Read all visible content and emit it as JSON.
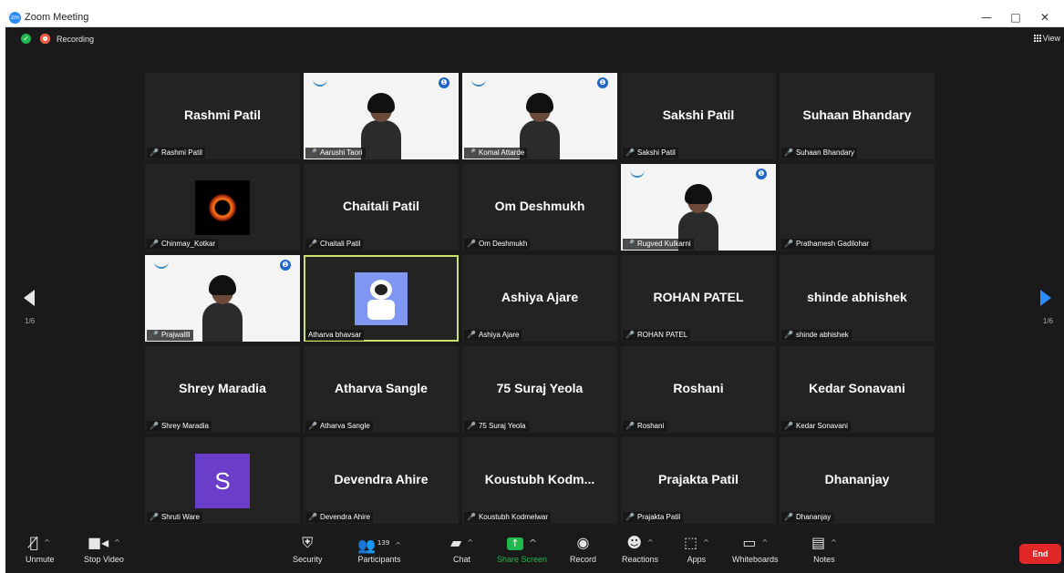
{
  "window": {
    "title": "Zoom Meeting",
    "minimize": "—",
    "restore": "□",
    "close": "✕"
  },
  "topbar": {
    "recording": "Recording",
    "view": "View"
  },
  "pages": {
    "left": "1/6",
    "right": "1/6"
  },
  "tiles": [
    {
      "name": "Rashmi Patil",
      "label": "Rashmi Patil",
      "type": "name"
    },
    {
      "name": "Aarushi Taori",
      "label": "Aarushi Taori",
      "type": "video"
    },
    {
      "name": "Komal Attarde",
      "label": "Komal Attarde",
      "type": "video"
    },
    {
      "name": "Sakshi Patil",
      "label": "Sakshi Patil",
      "type": "name"
    },
    {
      "name": "Suhaan Bhandary",
      "label": "Suhaan Bhandary",
      "type": "name"
    },
    {
      "name": "Chinmay_Kotkar",
      "label": "Chinmay_Kotkar",
      "type": "image-blackhole"
    },
    {
      "name": "Chaitali Patil",
      "label": "Chaitali Patil",
      "type": "name"
    },
    {
      "name": "Om Deshmukh",
      "label": "Om Deshmukh",
      "type": "name"
    },
    {
      "name": "Rugved Kulkarni",
      "label": "Rugved Kulkarni",
      "type": "video"
    },
    {
      "name": "Prathamesh Gadilohar",
      "label": "Prathamesh Gadilohar",
      "type": "blank"
    },
    {
      "name": "Prajwallll",
      "label": "Prajwallll",
      "type": "video"
    },
    {
      "name": "Atharva bhavsar",
      "label": "Atharva bhavsar",
      "type": "image-astronaut"
    },
    {
      "name": "Ashiya Ajare",
      "label": "Ashiya Ajare",
      "type": "name"
    },
    {
      "name": "ROHAN PATEL",
      "label": "ROHAN PATEL",
      "type": "name"
    },
    {
      "name": "shinde abhishek",
      "label": "shinde abhishek",
      "type": "name"
    },
    {
      "name": "Shrey Maradia",
      "label": "Shrey Maradia",
      "type": "name"
    },
    {
      "name": "Atharva Sangle",
      "label": "Atharva Sangle",
      "type": "name"
    },
    {
      "name": "75 Suraj Yeola",
      "label": "75 Suraj Yeola",
      "type": "name"
    },
    {
      "name": "Roshani",
      "label": "Roshani",
      "type": "name"
    },
    {
      "name": "Kedar Sonavani",
      "label": "Kedar Sonavani",
      "type": "name"
    },
    {
      "name": "Shruti Ware",
      "label": "Shruti Ware",
      "type": "avatar",
      "avatar": "S"
    },
    {
      "name": "Devendra Ahire",
      "label": "Devendra Ahire",
      "type": "name"
    },
    {
      "name": "Koustubh Kodm...",
      "label": "Koustubh Kodmelwar",
      "type": "name"
    },
    {
      "name": "Prajakta Patil",
      "label": "Prajakta Patil",
      "type": "name"
    },
    {
      "name": "Dhananjay",
      "label": "Dhananjay",
      "type": "name"
    }
  ],
  "toolbar": {
    "unmute": "Unmute",
    "stop_video": "Stop Video",
    "security": "Security",
    "participants": "Participants",
    "participants_count": "139",
    "chat": "Chat",
    "share_screen": "Share Screen",
    "record": "Record",
    "reactions": "Reactions",
    "apps": "Apps",
    "whiteboards": "Whiteboards",
    "notes": "Notes",
    "end": "End"
  },
  "colors": {
    "active_speaker": "#c9e26d",
    "share": "#21b94f",
    "end": "#e02828",
    "accent": "#2d8cff"
  }
}
